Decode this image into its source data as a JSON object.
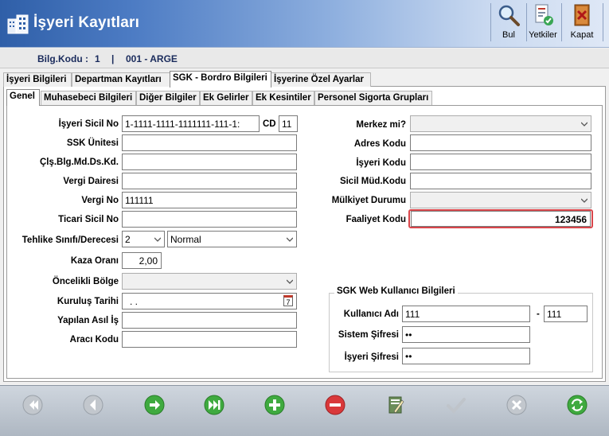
{
  "window": {
    "title": "İşyeri Kayıtları"
  },
  "toolbar": {
    "find_label": "Bul",
    "permissions_label": "Yetkiler",
    "close_label": "Kapat"
  },
  "info": {
    "company_code_label": "Bilg.Kodu :",
    "company_code": "1",
    "separator": "|",
    "company_name": "001 - ARGE"
  },
  "main_tabs": [
    {
      "label": "İşyeri Bilgileri"
    },
    {
      "label": "Departman Kayıtları"
    },
    {
      "label": "SGK - Bordro  Bilgileri"
    },
    {
      "label": "İşyerine Özel Ayarlar"
    }
  ],
  "sub_tabs": [
    {
      "label": "Genel"
    },
    {
      "label": "Muhasebeci Bilgileri"
    },
    {
      "label": "Diğer Bilgiler"
    },
    {
      "label": "Ek Gelirler"
    },
    {
      "label": "Ek Kesintiler"
    },
    {
      "label": "Personel Sigorta Grupları"
    }
  ],
  "left_form": {
    "sicil_no_label": "İşyeri Sicil No",
    "sicil_no_value": "1-1111-1111-1111111-111-1:",
    "cd_label": "CD",
    "cd_value": "11",
    "ssk_unitesi_label": "SSK Ünitesi",
    "ssk_unitesi_value": "",
    "cls_blg_label": "Çlş.Blg.Md.Ds.Kd.",
    "cls_blg_value": "",
    "vergi_dairesi_label": "Vergi Dairesi",
    "vergi_dairesi_value": "",
    "vergi_no_label": "Vergi No",
    "vergi_no_value": "111111",
    "ticari_sicil_label": "Ticari Sicil No",
    "ticari_sicil_value": "",
    "tehlike_label": "Tehlike Sınıfı/Derecesi",
    "tehlike_value": "2",
    "tehlike_level_value": "Normal",
    "kaza_orani_label": "Kaza Oranı",
    "kaza_orani_value": "2,00",
    "oncelikli_bolge_label": "Öncelikli Bölge",
    "oncelikli_bolge_value": "",
    "kurulus_tarihi_label": "Kuruluş Tarihi",
    "kurulus_tarihi_value": ". .",
    "kurulus_tarihi_calendar_glyph": "7",
    "yapilan_is_label": "Yapılan Asıl İş",
    "yapilan_is_value": "",
    "araci_kodu_label": "Aracı Kodu",
    "araci_kodu_value": ""
  },
  "right_form": {
    "merkez_label": "Merkez mi?",
    "merkez_value": "",
    "adres_kodu_label": "Adres Kodu",
    "adres_kodu_value": "",
    "isyeri_kodu_label": "İşyeri Kodu",
    "isyeri_kodu_value": "",
    "sicil_mud_label": "Sicil Müd.Kodu",
    "sicil_mud_value": "",
    "mulkiyet_label": "Mülkiyet Durumu",
    "mulkiyet_value": "",
    "faaliyet_label": "Faaliyet Kodu",
    "faaliyet_value": "123456",
    "highlight_color": "#d9454a"
  },
  "sgk_web": {
    "title": "SGK Web Kullanıcı Bilgileri",
    "kullanici_label": "Kullanıcı Adı",
    "kullanici_value": "111",
    "dash": "-",
    "kullanici_suffix_value": "111",
    "sistem_sifresi_label": "Sistem Şifresi",
    "sistem_sifresi_value": "••",
    "isyeri_sifresi_label": "İşyeri Şifresi",
    "isyeri_sifresi_value": "••"
  },
  "bottom_nav": {
    "icons": [
      "first-icon",
      "previous-icon",
      "next-icon",
      "last-icon",
      "add-icon",
      "delete-icon",
      "edit-icon",
      "save-icon",
      "cancel-icon",
      "refresh-icon"
    ]
  }
}
